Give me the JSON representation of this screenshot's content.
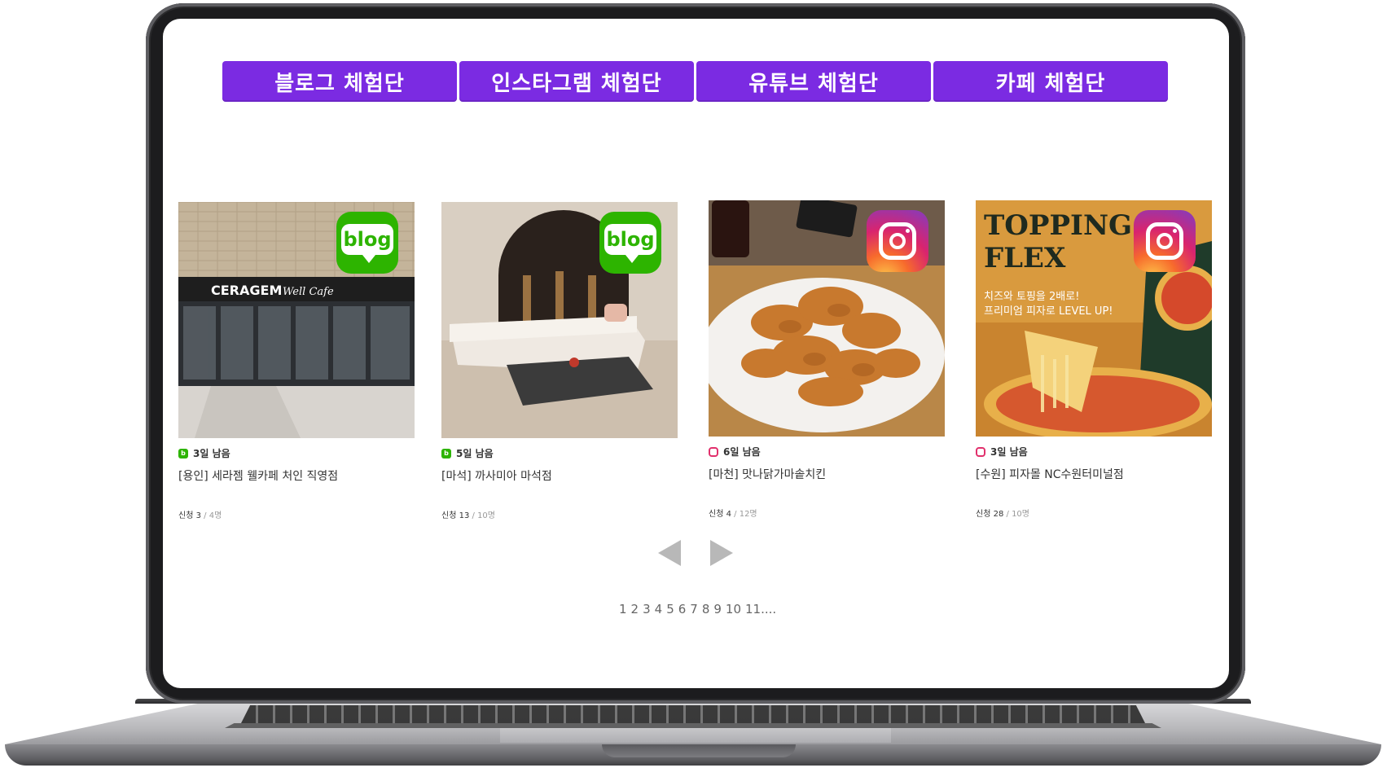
{
  "tabs": [
    {
      "label": "블로그 체험단"
    },
    {
      "label": "인스타그램 체험단"
    },
    {
      "label": "유튜브 체험단"
    },
    {
      "label": "카페 체험단"
    }
  ],
  "cards": [
    {
      "type": "blog",
      "icon": "naver-blog-icon",
      "badge_text": "blog",
      "days_left": "3일 남음",
      "title": "[용인] 세라젬 웰카페 처인 직영점",
      "apply_label": "신청",
      "apply_count": "3",
      "capacity": "/ 4명",
      "photo_text": "CERAGEM Well Cafe"
    },
    {
      "type": "blog",
      "icon": "naver-blog-icon",
      "badge_text": "blog",
      "days_left": "5일 남음",
      "title": "[마석] 까사미아 마석점",
      "apply_label": "신청",
      "apply_count": "13",
      "capacity": "/ 10명"
    },
    {
      "type": "insta",
      "icon": "instagram-icon",
      "days_left": "6일 남음",
      "title": "[마천] 맛나닭가마솥치킨",
      "apply_label": "신청",
      "apply_count": "4",
      "capacity": "/ 12명"
    },
    {
      "type": "insta",
      "icon": "instagram-icon",
      "days_left": "3일 남음",
      "title": "[수원] 피자몰 NC수원터미널점",
      "apply_label": "신청",
      "apply_count": "28",
      "capacity": "/ 10명",
      "photo_text": [
        "TOPPING",
        "FLEX",
        "치즈와 토핑을 2배로!",
        "프리미엄 피자로 LEVEL UP!"
      ]
    }
  ],
  "pagination": {
    "pages": [
      "1",
      "2",
      "3",
      "4",
      "5",
      "6",
      "7",
      "8",
      "9",
      "10",
      "11...."
    ]
  },
  "colors": {
    "accent": "#7b2be2",
    "blog_green": "#2db400",
    "instagram": "#e1306c"
  }
}
